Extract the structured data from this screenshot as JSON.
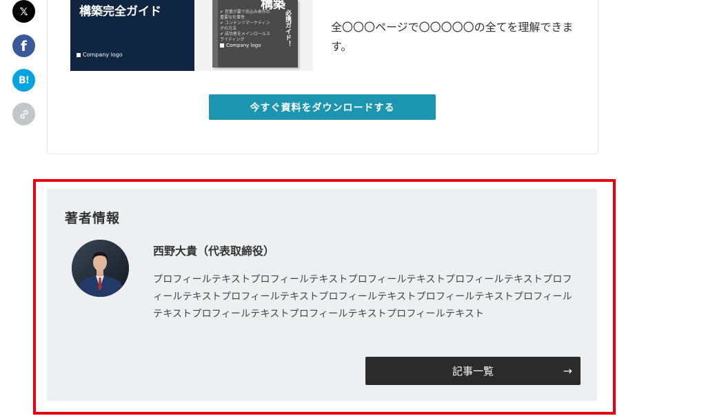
{
  "share": {
    "x_glyph": "𝕏",
    "facebook_glyph": "f",
    "hatena_glyph": "B!",
    "icons": [
      "x-icon",
      "facebook-icon",
      "hatena-bookmark-icon",
      "link-icon"
    ]
  },
  "download": {
    "cover_title": "構築完全ガイド",
    "company_logo": "Company logo",
    "cover2_top": "構築",
    "cover2_vertical": "必携ガイド！",
    "cover2_lines": "✔ 営業が要で売込み表作の重要な仕事性\n✔ コンテンツマーケティングの方法\n✔ 成功者をメインロールスライティング",
    "description": "全〇〇〇ページで〇〇〇〇〇の全てを理解できます。",
    "button_label": "今すぐ資料をダウンロードする",
    "button_color": "#1b95b0"
  },
  "author": {
    "heading": "著者情報",
    "name": "西野大貴（代表取締役）",
    "bio": "プロフィールテキストプロフィールテキストプロフィールテキストプロフィールテキストプロフィールテキストプロフィールテキストプロフィールテキストプロフィールテキストプロフィールテキストプロフィールテキストプロフィールテキストプロフィールテキスト",
    "articles_button_label": "記事一覧",
    "arrow_glyph": "→",
    "highlight_color": "#e60012"
  }
}
